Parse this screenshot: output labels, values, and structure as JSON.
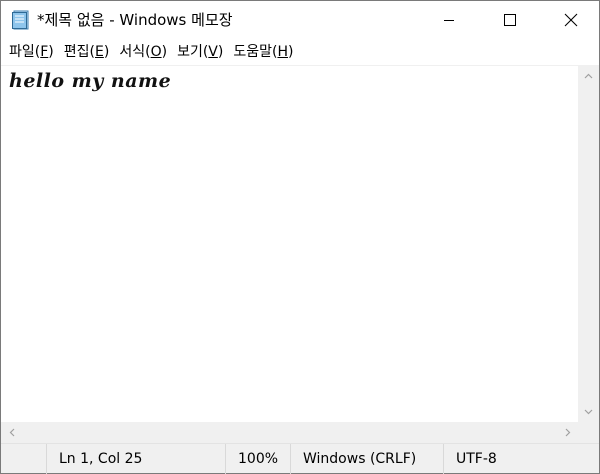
{
  "window": {
    "title": "*제목 없음 - Windows 메모장",
    "controls": {
      "minimize": "minimize-icon",
      "maximize": "maximize-icon",
      "close": "close-icon"
    }
  },
  "menu": [
    {
      "label": "파일",
      "key": "F"
    },
    {
      "label": "편집",
      "key": "E"
    },
    {
      "label": "서식",
      "key": "O"
    },
    {
      "label": "보기",
      "key": "V"
    },
    {
      "label": "도움말",
      "key": "H"
    }
  ],
  "editor": {
    "content": "hello my name"
  },
  "status": {
    "position": "Ln 1, Col 25",
    "zoom": "100%",
    "line_ending": "Windows (CRLF)",
    "encoding": "UTF-8"
  },
  "colors": {
    "chrome": "#f0f0f0",
    "arrow": "#a0a0a0",
    "icon_blue": "#5aa9e6"
  }
}
